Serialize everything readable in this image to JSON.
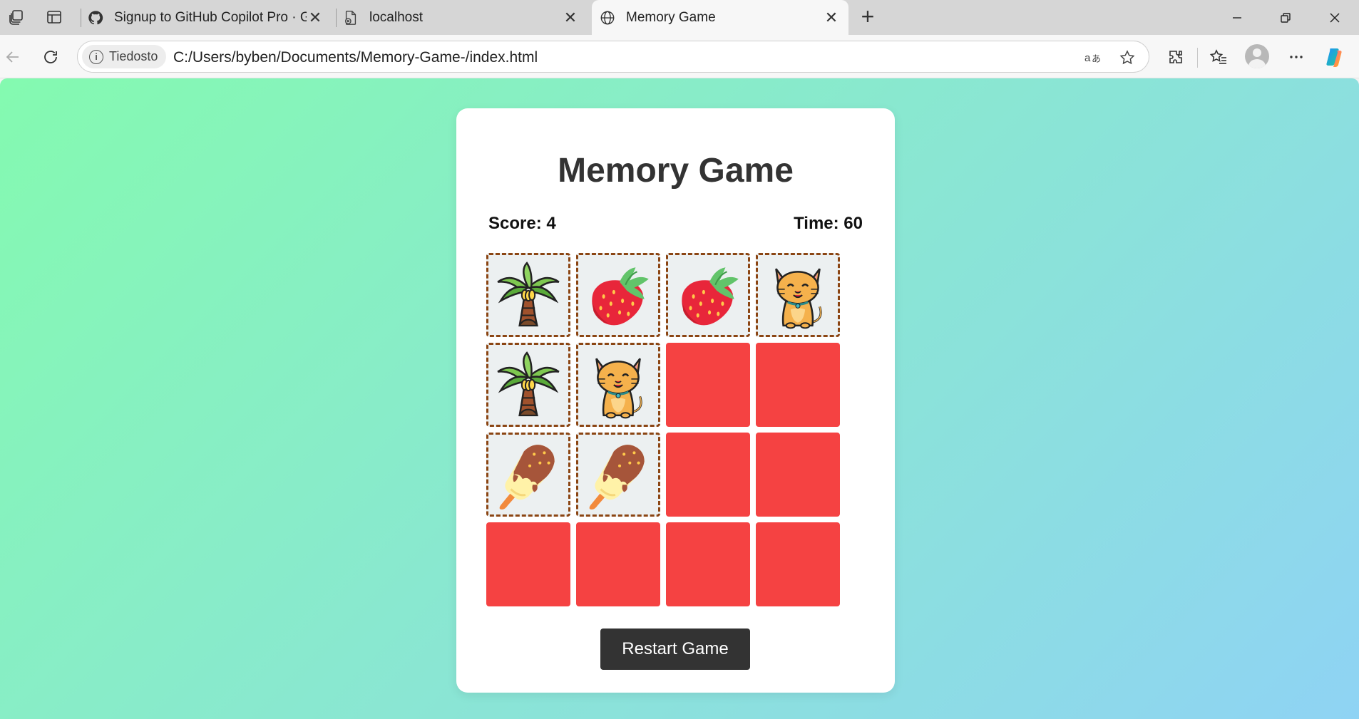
{
  "browser": {
    "tabs": [
      {
        "title": "Signup to GitHub Copilot Pro · GitHub",
        "favicon": "github-icon",
        "active": false
      },
      {
        "title": "localhost",
        "favicon": "broken-page-icon",
        "active": false
      },
      {
        "title": "Memory Game",
        "favicon": "globe-icon",
        "active": true
      }
    ],
    "site_chip": "Tiedosto",
    "url": "C:/Users/byben/Documents/Memory-Game-/index.html"
  },
  "game": {
    "title": "Memory Game",
    "score_text": "Score: 4",
    "time_text": "Time: 60",
    "restart_label": "Restart Game",
    "cards": [
      {
        "state": "flipped",
        "icon": "palm-tree-icon"
      },
      {
        "state": "flipped",
        "icon": "strawberry-icon"
      },
      {
        "state": "flipped",
        "icon": "strawberry-icon"
      },
      {
        "state": "flipped",
        "icon": "cat-icon"
      },
      {
        "state": "flipped",
        "icon": "palm-tree-icon"
      },
      {
        "state": "flipped",
        "icon": "cat-icon"
      },
      {
        "state": "hidden",
        "icon": ""
      },
      {
        "state": "hidden",
        "icon": ""
      },
      {
        "state": "flipped",
        "icon": "ice-cream-icon"
      },
      {
        "state": "flipped",
        "icon": "ice-cream-icon"
      },
      {
        "state": "hidden",
        "icon": ""
      },
      {
        "state": "hidden",
        "icon": ""
      },
      {
        "state": "hidden",
        "icon": ""
      },
      {
        "state": "hidden",
        "icon": ""
      },
      {
        "state": "hidden",
        "icon": ""
      },
      {
        "state": "hidden",
        "icon": ""
      }
    ],
    "colors": {
      "hidden_card": "#f54242",
      "flipped_card_bg": "#ecf0f1",
      "flipped_card_border": "#8b4513",
      "button_bg": "#333333",
      "gradient_start": "#84fab0",
      "gradient_end": "#8fd3f4"
    }
  }
}
